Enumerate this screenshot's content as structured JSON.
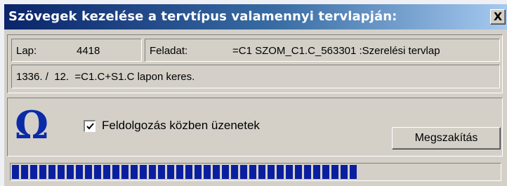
{
  "window": {
    "title": "Szövegek kezelése a tervtípus valamennyi tervlapján:",
    "close_glyph": "X"
  },
  "info": {
    "lap_label": "Lap:",
    "lap_value": "4418",
    "feladat_label": "Feladat:",
    "feladat_value": "=C1 SZOM_C1.C_563301 :Szerelési tervlap",
    "status_text": "1336. /  12.  =C1.C+S1.C lapon keres."
  },
  "controls": {
    "icon": "omega-icon",
    "checkbox_label": "Feldolgozás közben üzenetek",
    "checkbox_checked": true,
    "cancel_label": "Megszakítás"
  },
  "progress": {
    "fraction": 0.71
  },
  "colors": {
    "title_gradient_start": "#0a246a",
    "title_gradient_end": "#a6caf0",
    "progress_block": "#0a1fa0",
    "omega": "#0a2aa8",
    "dialog_face": "#d4d0c8"
  }
}
